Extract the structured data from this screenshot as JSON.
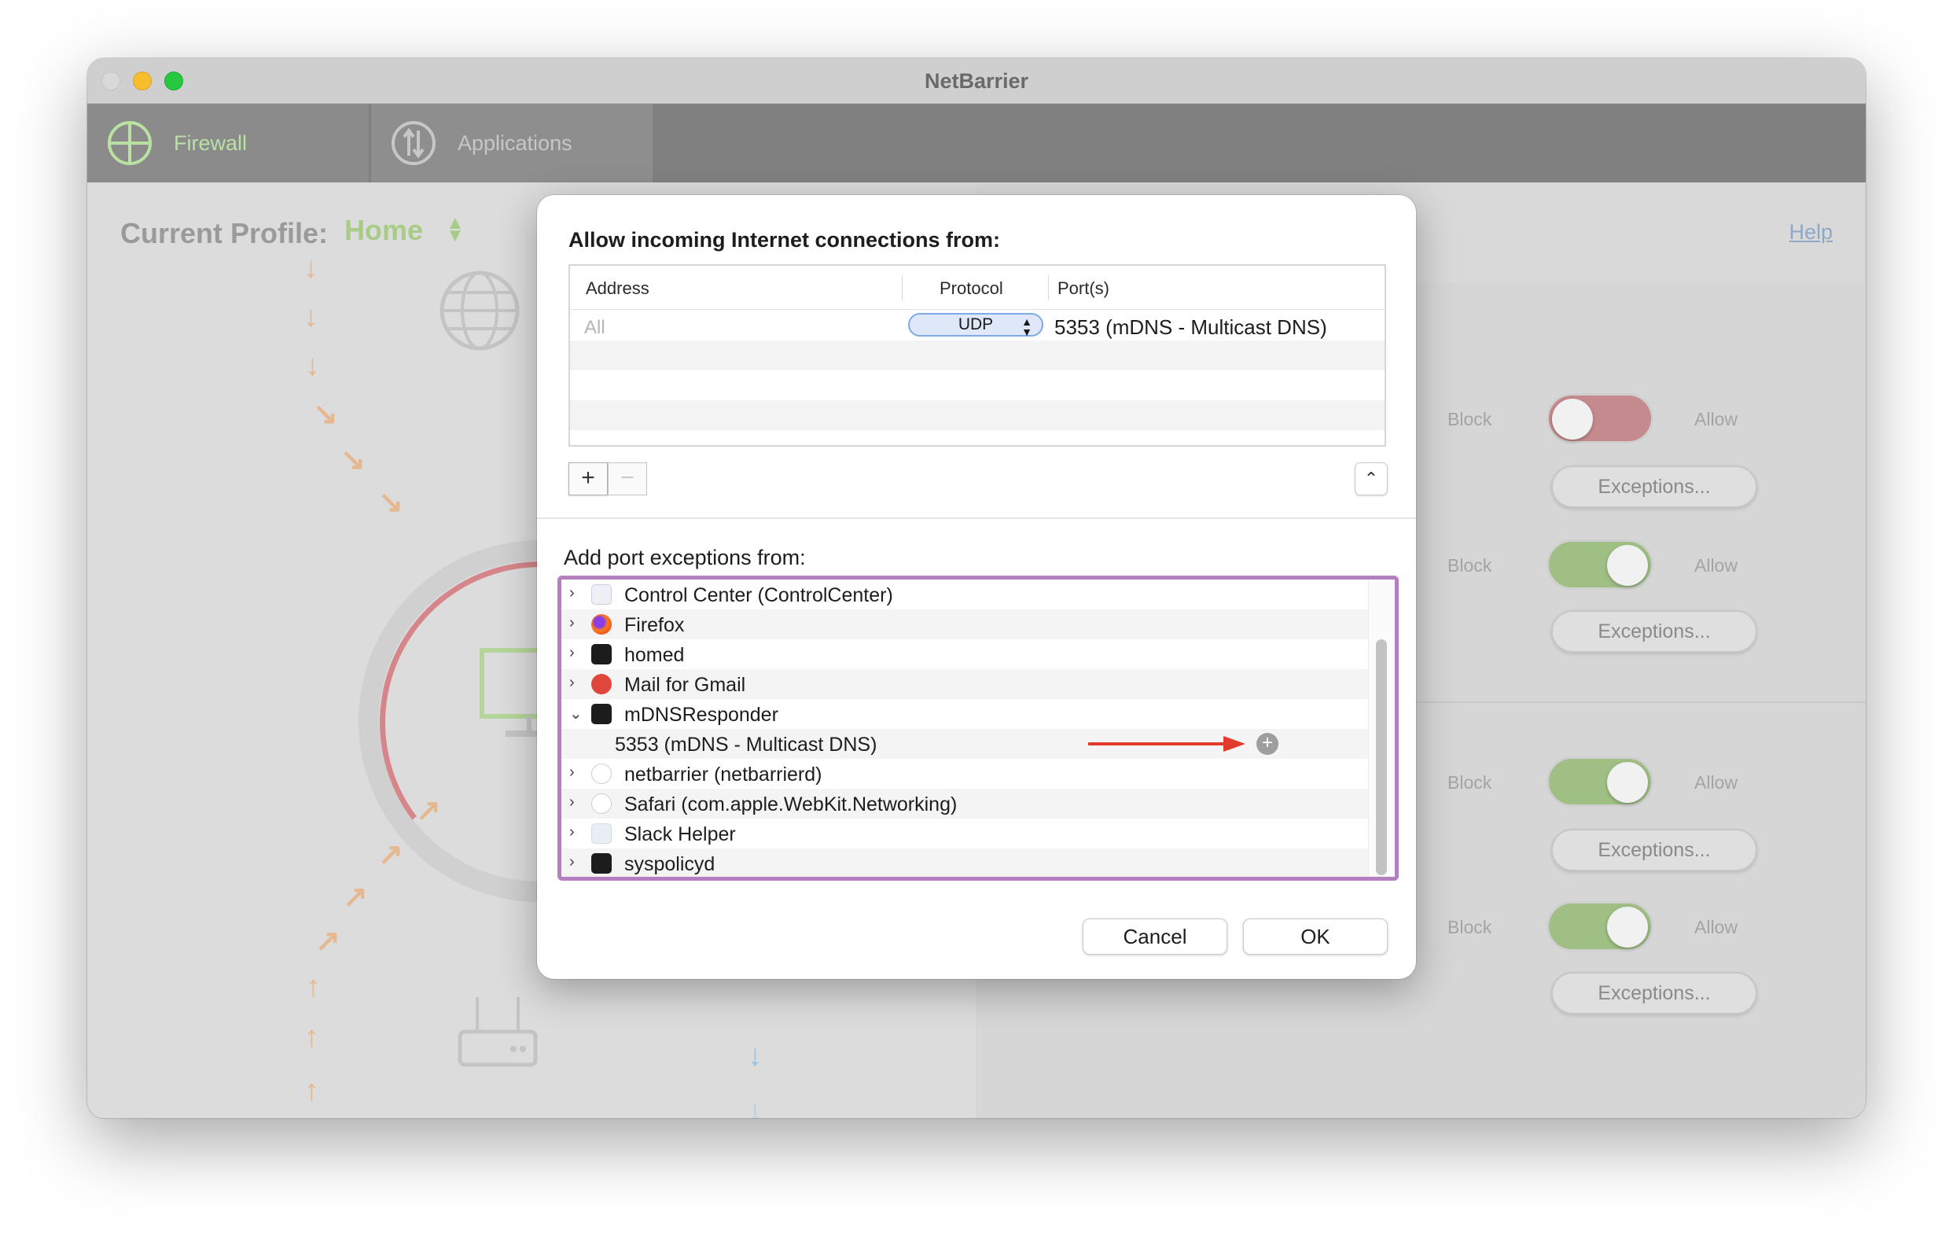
{
  "window": {
    "title": "NetBarrier"
  },
  "toolbar": {
    "tabs": [
      {
        "label": "Firewall"
      },
      {
        "label": "Applications"
      }
    ]
  },
  "profile": {
    "label": "Current Profile:",
    "value": "Home"
  },
  "help_link": "Help",
  "switches": [
    {
      "block": "Block",
      "allow": "Allow",
      "state": "block",
      "button": "Exceptions..."
    },
    {
      "block": "Block",
      "allow": "Allow",
      "state": "allow",
      "button": "Exceptions..."
    },
    {
      "block": "Block",
      "allow": "Allow",
      "state": "allow",
      "button": "Exceptions..."
    },
    {
      "block": "Block",
      "allow": "Allow",
      "state": "allow",
      "button": "Exceptions..."
    }
  ],
  "modal": {
    "title": "Allow incoming Internet connections from:",
    "columns": {
      "address": "Address",
      "protocol": "Protocol",
      "ports": "Port(s)"
    },
    "rule": {
      "address": "All",
      "protocol": "UDP",
      "ports": "5353 (mDNS - Multicast DNS)"
    },
    "plus": "+",
    "minus": "−",
    "subtitle": "Add port exceptions from:",
    "apps": [
      {
        "label": "Control Center (ControlCenter)",
        "icon": "control-center-icon",
        "expanded": false
      },
      {
        "label": "Firefox",
        "icon": "firefox-icon",
        "expanded": false
      },
      {
        "label": "homed",
        "icon": "terminal-icon",
        "expanded": false
      },
      {
        "label": "Mail for Gmail",
        "icon": "mail-icon",
        "expanded": false
      },
      {
        "label": "mDNSResponder",
        "icon": "terminal-icon",
        "expanded": true
      },
      {
        "label": "5353 (mDNS - Multicast DNS)",
        "child": true
      },
      {
        "label": "netbarrier (netbarrierd)",
        "icon": "shield-icon",
        "expanded": false
      },
      {
        "label": "Safari (com.apple.WebKit.Networking)",
        "icon": "shield-icon",
        "expanded": false
      },
      {
        "label": "Slack Helper",
        "icon": "blank-app-icon",
        "expanded": false
      },
      {
        "label": "syspolicyd",
        "icon": "terminal-icon",
        "expanded": false
      }
    ],
    "cancel": "Cancel",
    "ok": "OK"
  },
  "colors": {
    "accent_highlight": "#b47fbf",
    "annotation_arrow": "#e23b2b",
    "firewall_green": "#a8cc86"
  }
}
